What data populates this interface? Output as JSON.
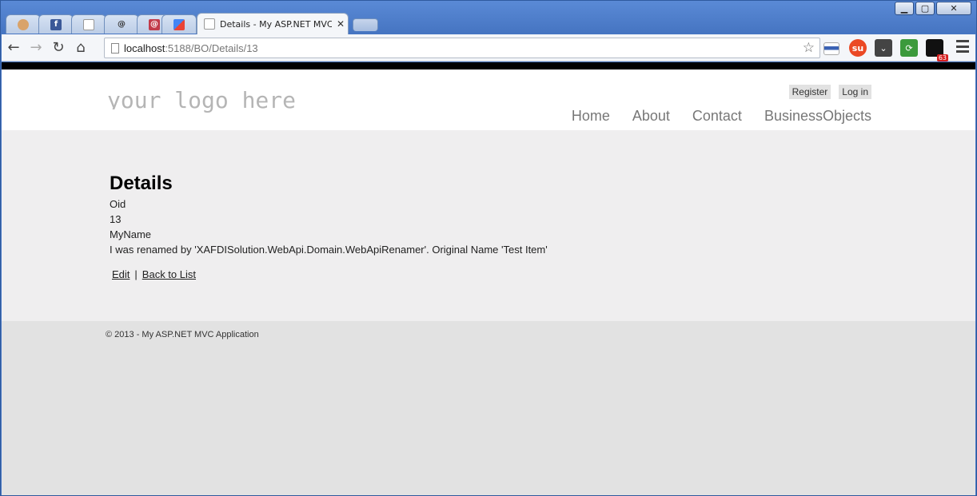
{
  "browser": {
    "tabs": [
      {
        "icon": "person-icon",
        "title": ""
      },
      {
        "icon": "facebook-icon",
        "title": ""
      },
      {
        "icon": "page-icon",
        "title": ""
      },
      {
        "icon": "at-icon",
        "title": ""
      },
      {
        "icon": "at-red-icon",
        "title": ""
      },
      {
        "icon": "google-icon",
        "title": ""
      }
    ],
    "active_tab": {
      "title": "Details - My ASP.NET MVC Ap",
      "close": "✕"
    },
    "url": {
      "host": "localhost",
      "rest": ":5188/BO/Details/13"
    },
    "extension_badge": "63"
  },
  "site": {
    "logo": "your logo here",
    "auth": {
      "register": "Register",
      "login": "Log in"
    },
    "menu": [
      "Home",
      "About",
      "Contact",
      "BusinessObjects"
    ]
  },
  "main": {
    "heading": "Details",
    "fields": [
      {
        "label": "Oid",
        "value": "13"
      },
      {
        "label": "MyName",
        "value": "I was renamed by 'XAFDISolution.WebApi.Domain.WebApiRenamer'. Original Name 'Test Item'"
      }
    ],
    "links": {
      "edit": "Edit",
      "separator": "|",
      "back": "Back to List"
    }
  },
  "footer": {
    "text": "© 2013 - My ASP.NET MVC Application"
  }
}
